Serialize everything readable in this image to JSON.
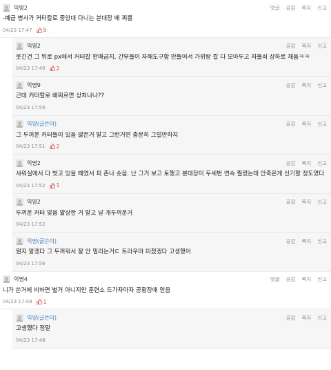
{
  "actions": {
    "reply": "댓글",
    "like": "공감",
    "dislike": "폭지",
    "report": "신고"
  },
  "colors": {
    "like": "#d84a3c",
    "writer": "#3f7fc9",
    "reply_bg": "#f6f6f6"
  },
  "comments": [
    {
      "type": "top",
      "nick": "익명2",
      "writer": false,
      "text": "-폐급 병사가 커터칼로 중앙대 다니는 분대장 배 찌름",
      "time": "04/23 17:47",
      "likes": "5",
      "show_reply": true
    },
    {
      "type": "reply",
      "nick": "익명2",
      "writer": false,
      "text": "웃긴건 그 뒤로 px에서 커터칼 판매금지, 간부들이 자해도구함 만들어서 가위랑 칼 다 모아두고 자물쇠 상하로 채움ㅋㅋ",
      "time": "04/23 17:49",
      "likes": "2"
    },
    {
      "type": "reply",
      "nick": "익명9",
      "writer": false,
      "text": "근데 커터칼로 배찌르면 상처나나??",
      "time": "04/23 17:50",
      "likes": ""
    },
    {
      "type": "reply",
      "nick": "익명(글쓴이)",
      "writer": true,
      "text": "그 두꺼운 커터들이 있음 얇은거 말고 그런거면 충분히 그럴만하지",
      "time": "04/23 17:51",
      "likes": "2"
    },
    {
      "type": "reply",
      "nick": "익명2",
      "writer": false,
      "text": "샤워실에서 다 벗고 있을 때였서 피 존나 솟음. 난 그거 보고 토했고 분대장이 두세번 연속 찔렸는데 안죽은게 신기할 정도였다",
      "time": "04/23 17:52",
      "likes": "1"
    },
    {
      "type": "reply",
      "nick": "익명2",
      "writer": false,
      "text": "두꺼운 커터 맞음 얇상한 거 말고 날 개두꺼운거",
      "time": "04/23 17:52",
      "likes": ""
    },
    {
      "type": "reply",
      "nick": "익명(글쓴이)",
      "writer": true,
      "text": "뭔지 알겠다 그 두꺼워서 잘 안 밀리는거ㄷ 트라우마 미쳤겠다 고생했어",
      "time": "04/23 17:56",
      "likes": ""
    },
    {
      "type": "top",
      "nick": "익명4",
      "writer": false,
      "text": "니가 쓴거에 비하면 별거 아니지만 훈련소 드가자마자 공황장애 얻음",
      "time": "04/23 17:48",
      "likes": "1",
      "show_reply": true
    },
    {
      "type": "reply",
      "nick": "익명(글쓴이)",
      "writer": true,
      "text": "고생했다 정말",
      "time": "04/23 17:48",
      "likes": ""
    }
  ]
}
